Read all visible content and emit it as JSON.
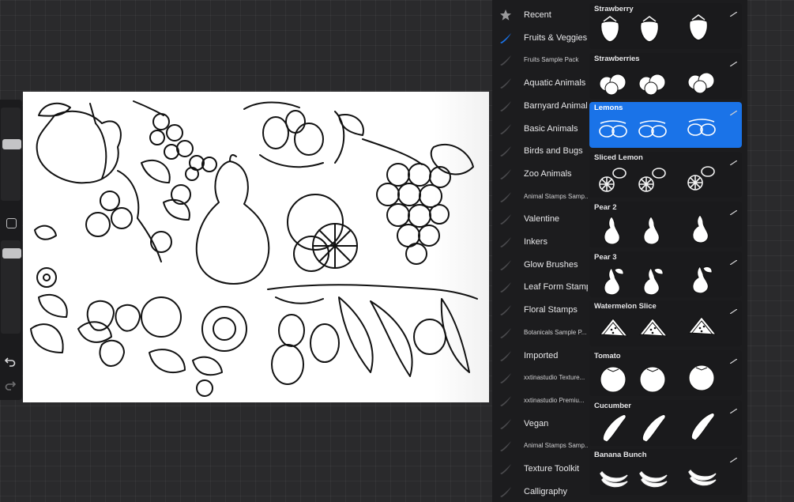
{
  "toolbar": {
    "undo_icon": "undo-arrow-icon",
    "redo_icon": "redo-arrow-icon",
    "modify_icon": "square-modify-icon"
  },
  "brush_library": {
    "sets": [
      {
        "label": "Recent",
        "icon": "star-icon",
        "small": false
      },
      {
        "label": "Fruits & Veggies",
        "icon": "brush-stroke-icon",
        "small": false,
        "selected": true
      },
      {
        "label": "Fruits Sample Pack",
        "icon": "brush-stroke-icon",
        "small": true
      },
      {
        "label": "Aquatic Animals",
        "icon": "brush-stroke-icon",
        "small": false
      },
      {
        "label": "Barnyard Animals",
        "icon": "brush-stroke-icon",
        "small": false
      },
      {
        "label": "Basic Animals",
        "icon": "brush-stroke-icon",
        "small": false
      },
      {
        "label": "Birds and Bugs",
        "icon": "brush-stroke-icon",
        "small": false
      },
      {
        "label": "Zoo Animals",
        "icon": "brush-stroke-icon",
        "small": false
      },
      {
        "label": "Animal Stamps Samp...",
        "icon": "brush-stroke-icon",
        "small": true
      },
      {
        "label": "Valentine",
        "icon": "brush-stroke-icon",
        "small": false
      },
      {
        "label": "Inkers",
        "icon": "brush-stroke-icon",
        "small": false
      },
      {
        "label": "Glow Brushes",
        "icon": "brush-stroke-icon",
        "small": false
      },
      {
        "label": "Leaf Form Stamps",
        "icon": "brush-stroke-icon",
        "small": false
      },
      {
        "label": "Floral Stamps",
        "icon": "brush-stroke-icon",
        "small": false
      },
      {
        "label": "Botanicals Sample P...",
        "icon": "brush-stroke-icon",
        "small": true
      },
      {
        "label": "Imported",
        "icon": "brush-stroke-icon",
        "small": false
      },
      {
        "label": "xxtinastudio Texture...",
        "icon": "brush-stroke-icon",
        "small": true
      },
      {
        "label": "xxtinastudio Premiu...",
        "icon": "brush-stroke-icon",
        "small": true
      },
      {
        "label": "Vegan",
        "icon": "brush-stroke-icon",
        "small": false
      },
      {
        "label": "Animal Stamps Samp...",
        "icon": "brush-stroke-icon",
        "small": true
      },
      {
        "label": "Texture Toolkit",
        "icon": "brush-stroke-icon",
        "small": false
      },
      {
        "label": "Calligraphy",
        "icon": "brush-stroke-icon",
        "small": false
      }
    ],
    "brushes": [
      {
        "name": "Strawberry",
        "stamp": "strawberry"
      },
      {
        "name": "Strawberries",
        "stamp": "strawberries"
      },
      {
        "name": "Lemons",
        "stamp": "lemons",
        "selected": true
      },
      {
        "name": "Sliced Lemon",
        "stamp": "sliced-lemon"
      },
      {
        "name": "Pear 2",
        "stamp": "pear"
      },
      {
        "name": "Pear 3",
        "stamp": "pear-leaf"
      },
      {
        "name": "Watermelon Slice",
        "stamp": "watermelon"
      },
      {
        "name": "Tomato",
        "stamp": "tomato"
      },
      {
        "name": "Cucumber",
        "stamp": "cucumber"
      },
      {
        "name": "Banana Bunch",
        "stamp": "banana"
      }
    ]
  },
  "colors": {
    "panel_bg": "#1c1c1e",
    "selection_accent": "#1a73e8",
    "canvas_bg": "#ffffff",
    "workspace_bg": "#2a2a2c"
  }
}
